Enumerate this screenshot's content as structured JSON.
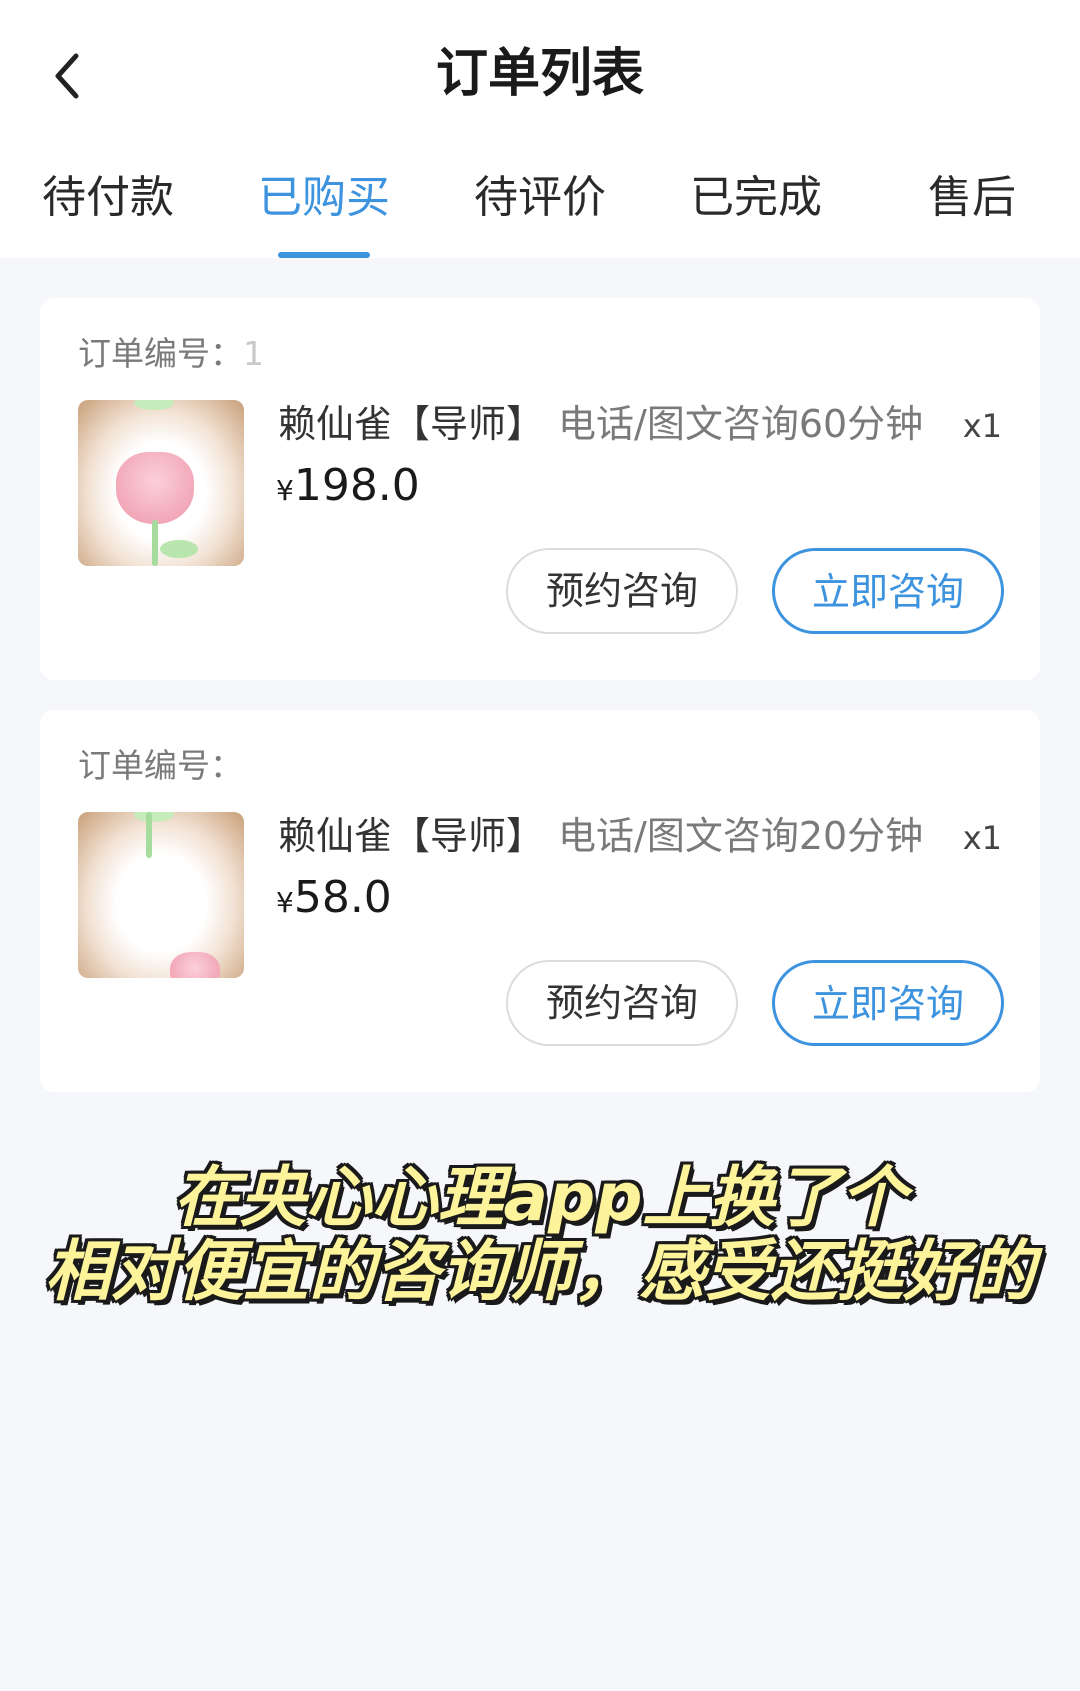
{
  "header": {
    "title": "订单列表",
    "back_icon": "chevron-left-icon"
  },
  "tabs": [
    {
      "label": "待付款",
      "active": false
    },
    {
      "label": "已购买",
      "active": true
    },
    {
      "label": "待评价",
      "active": false
    },
    {
      "label": "已完成",
      "active": false
    },
    {
      "label": "售后",
      "active": false
    }
  ],
  "accent_color": "#3d93de",
  "orders": [
    {
      "order_no_label": "订单编号：",
      "order_no_value": "1",
      "name": "赖仙雀【导师】",
      "desc": "电话/图文咨询60分钟",
      "qty": "x1",
      "currency": "¥",
      "price": "198.0",
      "reserve_label": "预约咨询",
      "consult_label": "立即咨询"
    },
    {
      "order_no_label": "订单编号：",
      "order_no_value": "",
      "name": "赖仙雀【导师】",
      "desc": "电话/图文咨询20分钟",
      "qty": "x1",
      "currency": "¥",
      "price": "58.0",
      "reserve_label": "预约咨询",
      "consult_label": "立即咨询"
    }
  ],
  "caption": {
    "line1": "在央心心理app上换了个",
    "line2": "相对便宜的咨询师，感受还挺好的"
  }
}
